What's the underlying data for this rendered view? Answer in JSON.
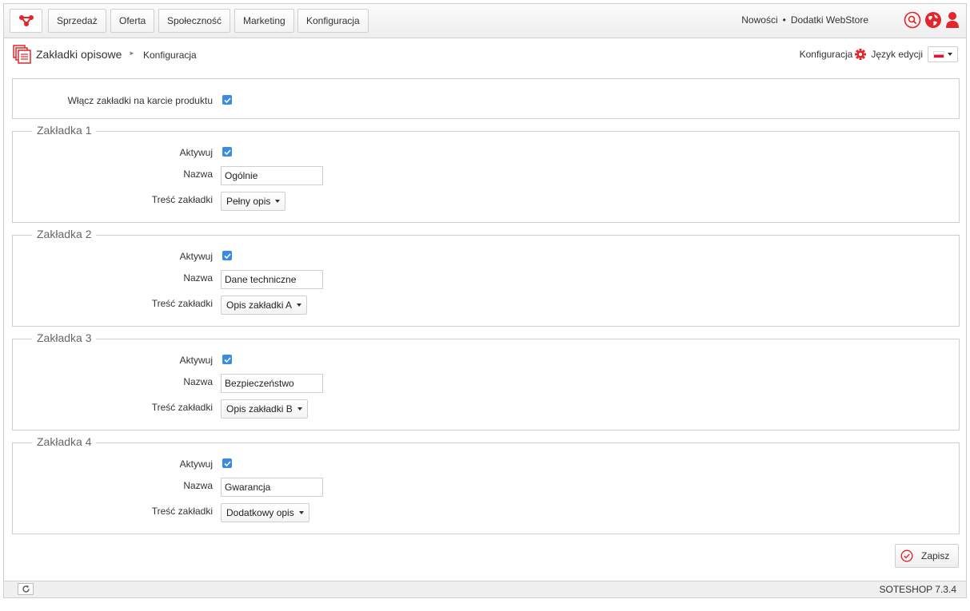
{
  "nav": {
    "items": [
      "Sprzedaż",
      "Oferta",
      "Społeczność",
      "Marketing",
      "Konfiguracja"
    ],
    "links": {
      "news": "Nowości",
      "separator": "•",
      "addons": "Dodatki WebStore"
    },
    "icons": [
      "search-icon",
      "globe-icon",
      "user-icon"
    ]
  },
  "breadcrumb": {
    "title": "Zakładki opisowe",
    "arrow": "►",
    "current": "Konfiguracja",
    "config_link": "Konfiguracja",
    "lang_label": "Język edycji",
    "lang_value": "pl"
  },
  "general": {
    "enable_label": "Włącz zakładki na karcie produktu",
    "enable_checked": true
  },
  "tabs": [
    {
      "legend": "Zakładka 1",
      "active_label": "Aktywuj",
      "active": true,
      "name_label": "Nazwa",
      "name_value": "Ogólnie",
      "content_label": "Treść zakładki",
      "content_value": "Pełny opis"
    },
    {
      "legend": "Zakładka 2",
      "active_label": "Aktywuj",
      "active": true,
      "name_label": "Nazwa",
      "name_value": "Dane techniczne",
      "content_label": "Treść zakładki",
      "content_value": "Opis zakładki A"
    },
    {
      "legend": "Zakładka 3",
      "active_label": "Aktywuj",
      "active": true,
      "name_label": "Nazwa",
      "name_value": "Bezpieczeństwo",
      "content_label": "Treść zakładki",
      "content_value": "Opis zakładki B"
    },
    {
      "legend": "Zakładka 4",
      "active_label": "Aktywuj",
      "active": true,
      "name_label": "Nazwa",
      "name_value": "Gwarancja",
      "content_label": "Treść zakładki",
      "content_value": "Dodatkowy opis"
    }
  ],
  "actions": {
    "save_label": "Zapisz"
  },
  "footer": {
    "version": "SOTESHOP 7.3.4"
  },
  "colors": {
    "brand": "#e3262b",
    "checkbox": "#3b8be0",
    "border": "#cfcfcf"
  }
}
